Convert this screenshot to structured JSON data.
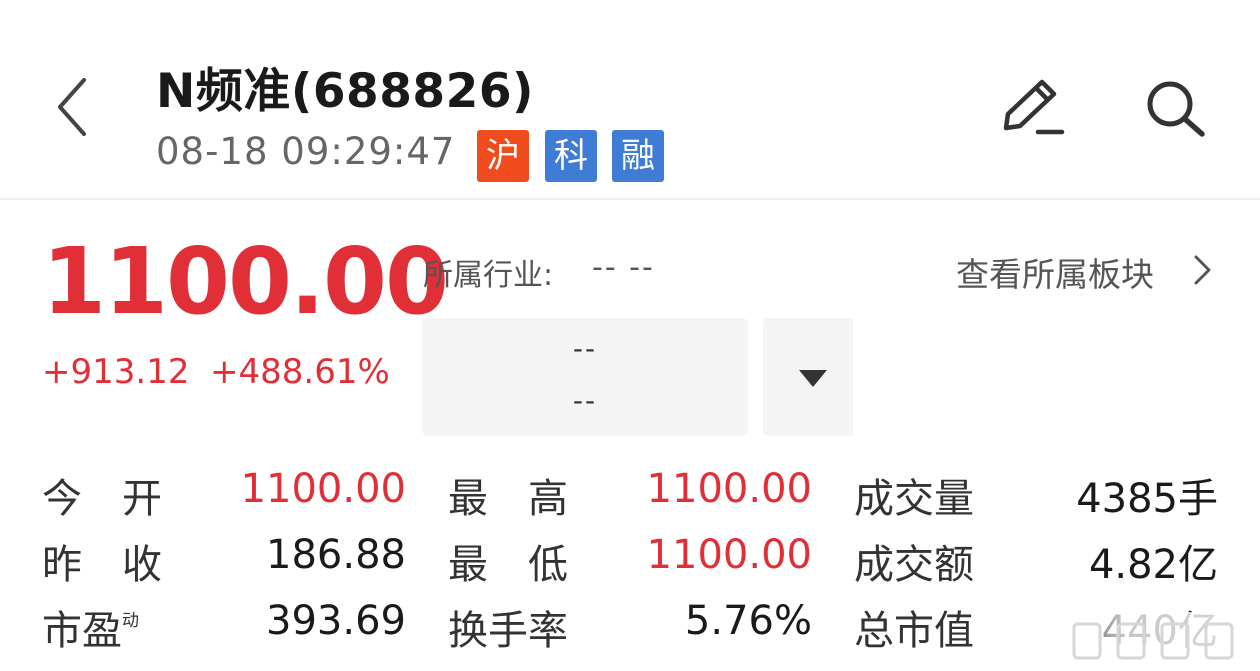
{
  "header": {
    "title": "N频准(688826)",
    "datetime": "08-18 09:29:47",
    "tags": [
      "沪",
      "科",
      "融"
    ]
  },
  "quote": {
    "price": "1100.00",
    "change": "+913.12",
    "change_pct": "+488.61%",
    "industry_label": "所属行业:",
    "industry_value": "-- --",
    "sector_link": "查看所属板块",
    "box_line1": "--",
    "box_line2": "--"
  },
  "stats": {
    "open_label": "今　开",
    "open_value": "1100.00",
    "high_label": "最　高",
    "high_value": "1100.00",
    "volume_label": "成交量",
    "volume_value": "4385手",
    "prev_close_label": "昨　收",
    "prev_close_value": "186.88",
    "low_label": "最　低",
    "low_value": "1100.00",
    "amount_label": "成交额",
    "amount_value": "4.82亿",
    "pe_label": "市盈",
    "pe_sup": "动",
    "pe_value": "393.69",
    "turnover_label": "换手率",
    "turnover_value": "5.76%",
    "mcap_label": "总市值",
    "mcap_value": "440亿"
  },
  "colors": {
    "up_red": "#e02f37",
    "tag_orange": "#f04c1e",
    "tag_blue": "#3e7cd6"
  },
  "icons": [
    "back-chevron-icon",
    "edit-pen-icon",
    "search-icon",
    "chevron-right-icon",
    "triangle-down-icon"
  ]
}
